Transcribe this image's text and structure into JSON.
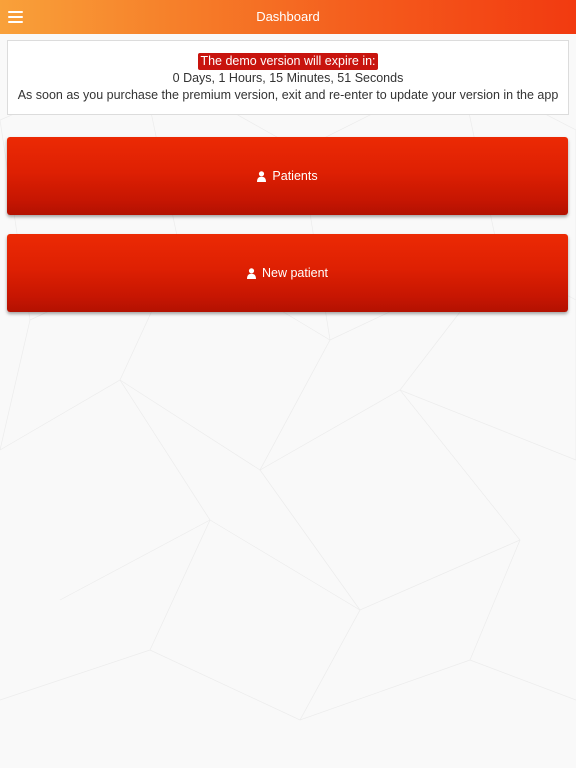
{
  "header": {
    "title": "Dashboard",
    "menu_icon": "hamburger-menu-icon"
  },
  "notice": {
    "badge_text": "The demo version will expire in:",
    "countdown": "0 Days, 1 Hours, 15 Minutes, 51 Seconds",
    "message": "As soon as you purchase the premium version, exit and re-enter to update your version in the app"
  },
  "buttons": [
    {
      "label": "Patients",
      "icon": "user-icon"
    },
    {
      "label": "New patient",
      "icon": "user-icon"
    }
  ],
  "colors": {
    "header_start": "#f9a13a",
    "header_end": "#f23a10",
    "button_red": "#de2003",
    "badge_red": "#c8140e",
    "background": "#f9f9f9"
  }
}
